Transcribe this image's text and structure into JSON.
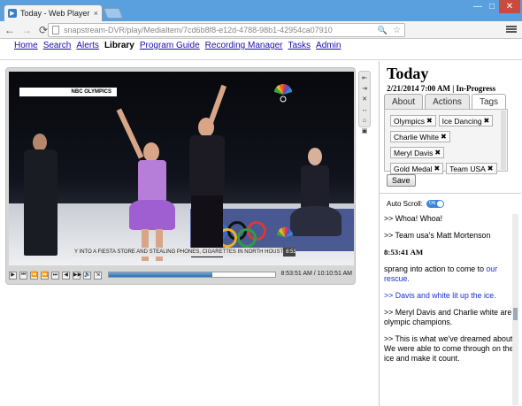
{
  "browser": {
    "tab_title": "Today - Web Player",
    "tab_close": "×",
    "url": "snapstream-DVR/play/MediaItem/7cd6b8f8-e12d-4788-98b1-42954ca07910",
    "win_minimize": "—",
    "win_maximize": "□",
    "win_close": "✕",
    "back": "←",
    "forward": "→",
    "reload": "⟳",
    "zoom_icon": "🔍",
    "star": "☆"
  },
  "nav": {
    "items": [
      {
        "label": "Home",
        "active": false
      },
      {
        "label": "Search",
        "active": false
      },
      {
        "label": "Alerts",
        "active": false
      },
      {
        "label": "Library",
        "active": true
      },
      {
        "label": "Program Guide",
        "active": false
      },
      {
        "label": "Recording Manager",
        "active": false
      },
      {
        "label": "Tasks",
        "active": false
      },
      {
        "label": "Admin",
        "active": false
      }
    ]
  },
  "player": {
    "network_label": "NBC OLYMPICS",
    "caption_text": "Y INTO A FIESTA STORE AND STEALING PHONES, CIGARETTES IN NORTH HOUST",
    "caption_time": "8:53 | 56",
    "controls": [
      "▶",
      "⏮",
      "⏪",
      "⏩",
      "⏭",
      "◀",
      "▶▶",
      "🔊",
      "⇲"
    ],
    "progress_fraction": 0.62,
    "timecode": "8:53:51 AM / 10:10:51 AM",
    "side_controls": [
      "⇤",
      "⇥",
      "✕",
      "↔",
      "⌂",
      "▣"
    ]
  },
  "panel": {
    "title": "Today",
    "datetime": "2/21/2014 7:00 AM | In-Progress",
    "tabs": [
      {
        "label": "About",
        "active": false
      },
      {
        "label": "Actions",
        "active": false
      },
      {
        "label": "Tags",
        "active": true
      }
    ],
    "tags": [
      "Olympics",
      "Ice Dancing",
      "Charlie White",
      "Meryl Davis",
      "Gold Medal",
      "Team USA"
    ],
    "tag_remove": "✖",
    "save_label": "Save",
    "autoscroll_label": "Auto Scroll:",
    "autoscroll_state": "ON"
  },
  "transcript": [
    {
      "text": ">> Whoa! Whoa!",
      "style": "normal"
    },
    {
      "text": ">> Team usa's Matt Mortenson",
      "style": "normal"
    },
    {
      "text": "8:53:41 AM",
      "style": "ts"
    },
    {
      "text": "sprang into action to come to ",
      "link": "our rescue.",
      "style": "mixed"
    },
    {
      "text": ">> Davis and white lit up the ice.",
      "style": "hl"
    },
    {
      "text": ">> Meryl Davis and Charlie white are olympic champions.",
      "style": "normal"
    },
    {
      "text": ">> This is what we've dreamed about. We were able to come through on the ice and make it count.",
      "style": "normal"
    }
  ]
}
